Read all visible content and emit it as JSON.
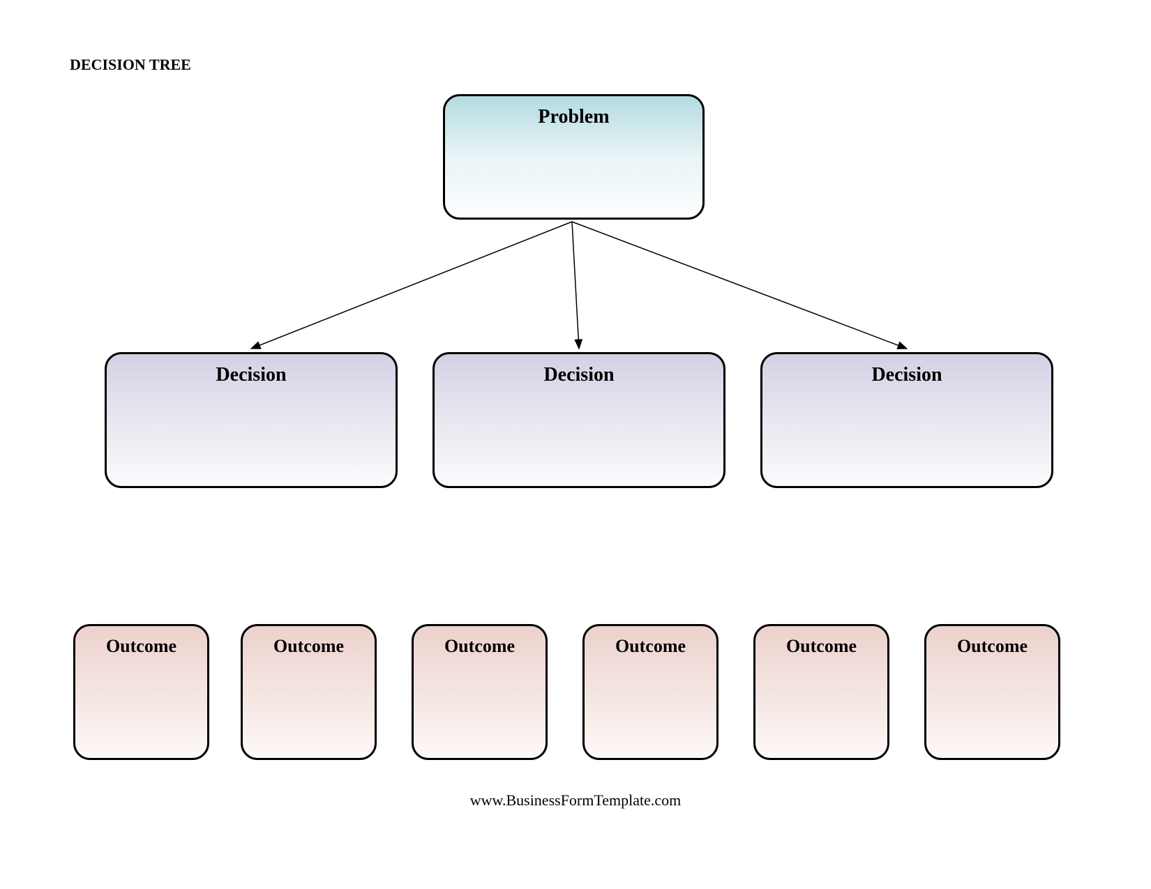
{
  "title": "DECISION TREE",
  "problem": {
    "label": "Problem"
  },
  "decisions": [
    {
      "label": "Decision"
    },
    {
      "label": "Decision"
    },
    {
      "label": "Decision"
    }
  ],
  "outcomes": [
    {
      "label": "Outcome"
    },
    {
      "label": "Outcome"
    },
    {
      "label": "Outcome"
    },
    {
      "label": "Outcome"
    },
    {
      "label": "Outcome"
    },
    {
      "label": "Outcome"
    }
  ],
  "footer": "www.BusinessFormTemplate.com"
}
